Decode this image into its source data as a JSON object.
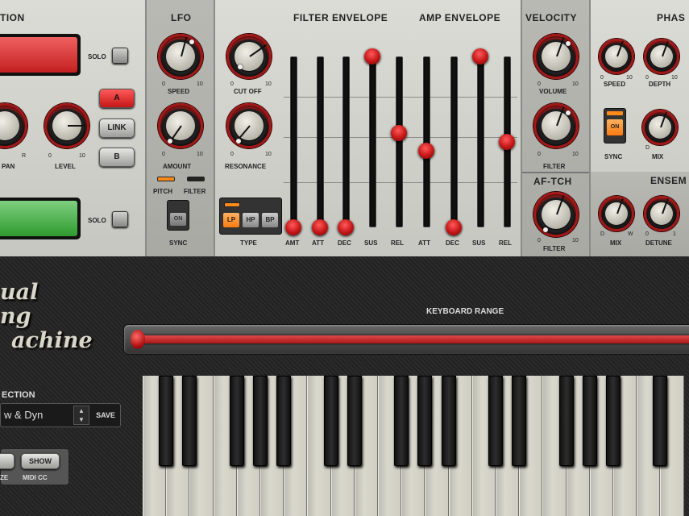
{
  "osc": {
    "title": "TION",
    "solo1": "SOLO",
    "solo2": "SOLO",
    "pan": "PAN",
    "pan_r": "R",
    "level": "LEVEL",
    "level_min": "0",
    "level_max": "10",
    "btn_a": "A",
    "btn_link": "LINK",
    "btn_b": "B"
  },
  "lfo": {
    "title": "LFO",
    "speed": "SPEED",
    "amount": "AMOUNT",
    "pitch": "PITCH",
    "filter": "FILTER",
    "sync": "SYNC",
    "on": "ON",
    "min": "0",
    "max": "10"
  },
  "filter": {
    "cutoff": "CUT OFF",
    "resonance": "RESONANCE",
    "type": "TYPE",
    "lp": "LP",
    "hp": "HP",
    "bp": "BP",
    "min": "0",
    "max": "10"
  },
  "filter_env": {
    "title": "FILTER ENVELOPE",
    "labels": [
      "AMT",
      "ATT",
      "DEC",
      "SUS",
      "REL"
    ],
    "levels": [
      0.0,
      0.0,
      0.0,
      1.0,
      0.55
    ]
  },
  "amp_env": {
    "title": "AMP ENVELOPE",
    "labels": [
      "ATT",
      "DEC",
      "SUS",
      "REL"
    ],
    "levels": [
      0.45,
      0.0,
      1.0,
      0.5
    ]
  },
  "velocity": {
    "title": "VELOCITY",
    "volume": "VOLUME",
    "filter": "FILTER",
    "min": "0",
    "max": "10"
  },
  "aftertouch": {
    "title": "AF-TCH",
    "filter": "FILTER",
    "min": "0",
    "max": "10"
  },
  "phaser": {
    "title": "PHAS",
    "speed": "SPEED",
    "depth": "DEPTH",
    "sync": "SYNC",
    "on": "ON",
    "mix": "MIX",
    "d": "D",
    "w": "W",
    "min": "0",
    "max": "10"
  },
  "ensemble": {
    "title": "ENSEM",
    "mix": "MIX",
    "detune": "DETUNE",
    "d": "D",
    "w": "W",
    "min": "0",
    "max": "1"
  },
  "logo": {
    "line1": "ual",
    "line2": "ng",
    "line3": "achine"
  },
  "keyboard_range": {
    "label": "KEYBOARD RANGE"
  },
  "preset": {
    "title": "ECTION",
    "name": "w & Dyn",
    "save": "SAVE"
  },
  "bottom": {
    "show": "SHOW",
    "ze": "ZE",
    "midi": "MIDI CC"
  },
  "colors": {
    "accent": "#c41616",
    "led_on": "#ff8a1a",
    "green": "#3fb33f"
  }
}
